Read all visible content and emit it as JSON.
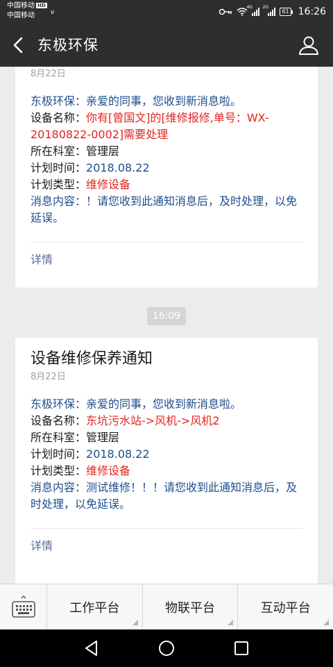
{
  "status_bar": {
    "carrier1": "中国移动",
    "carrier1_badge": "HD",
    "carrier2": "中国移动",
    "extra_glyph": "ν",
    "sig1_tag": "4G",
    "sig2_tag": "2G",
    "battery": "61",
    "time": "16:26",
    "icons": [
      "key-icon",
      "wifi-icon",
      "signal-icon",
      "battery-icon"
    ]
  },
  "header": {
    "title": "东极环保",
    "back_icon": "chevron-left-icon",
    "profile_icon": "person-icon"
  },
  "messages": [
    {
      "date": "8月22日",
      "lines": [
        {
          "label": "东极环保：",
          "value": "亲爱的同事，您收到新消息啦。",
          "label_color": "blue",
          "value_color": "blue"
        },
        {
          "label": "设备名称：",
          "value": "你有[曾国文]的[维修报修,单号：WX-20180822-0002]需要处理",
          "value_color": "red"
        },
        {
          "label": "所在科室：",
          "value": "管理层"
        },
        {
          "label": "计划时间：",
          "value": "2018.08.22",
          "value_color": "blue"
        },
        {
          "label": "计划类型：",
          "value": "维修设备",
          "value_color": "red"
        },
        {
          "label": "消息内容：",
          "value": "！请您收到此通知消息后，及时处理，以免延误。",
          "label_color": "blue",
          "value_color": "blue"
        }
      ],
      "detail": "详情"
    },
    {
      "title": "设备维修保养通知",
      "date": "8月22日",
      "lines": [
        {
          "label": "东极环保：",
          "value": "亲爱的同事，您收到新消息啦。",
          "label_color": "blue",
          "value_color": "blue"
        },
        {
          "label": "设备名称：",
          "value": "东坑污水站->风机->风机2",
          "value_color": "red"
        },
        {
          "label": "所在科室：",
          "value": "管理层"
        },
        {
          "label": "计划时间：",
          "value": "2018.08.22",
          "value_color": "blue"
        },
        {
          "label": "计划类型：",
          "value": "维修设备",
          "value_color": "red"
        },
        {
          "label": "消息内容：",
          "value": "测试维修！！！请您收到此通知消息后，及时处理，以免延误。",
          "label_color": "blue",
          "value_color": "blue"
        }
      ],
      "detail": "详情"
    }
  ],
  "time_separator": "16:09",
  "menu": {
    "keyboard_icon": "keyboard-icon",
    "items": [
      "工作平台",
      "物联平台",
      "互动平台"
    ]
  },
  "system_nav": [
    "back-triangle-icon",
    "home-circle-icon",
    "recents-square-icon"
  ],
  "colors": {
    "header_bg": "#2e2e2e",
    "blue_text": "#1e4d8c",
    "red_text": "#e5231f",
    "link": "#576b95",
    "page_bg": "#ececec"
  }
}
